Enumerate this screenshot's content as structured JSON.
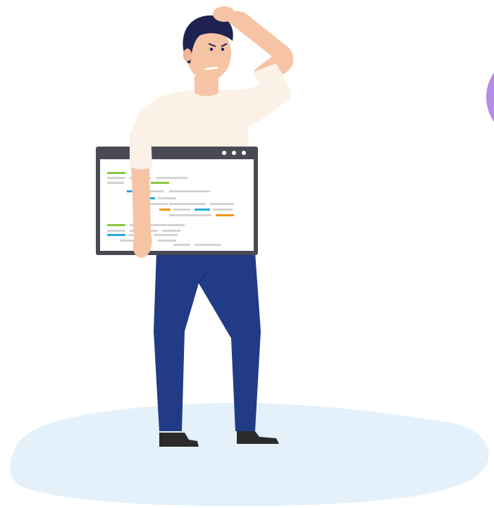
{
  "illustration": {
    "icon": "confused-developer-illustration",
    "colors": {
      "ground": "#e4f1fb",
      "shirt": "#fbf1e6",
      "pants": "#213b86",
      "skin": "#f6c4a5",
      "hair": "#1f2151",
      "shoes": "#2b2b2b",
      "window_frame": "#4a4a55",
      "window_body": "#ffffff",
      "accent_circle": "#b98be3",
      "code_green": "#8cc63f",
      "code_blue": "#29a8e0",
      "code_orange": "#f7941d",
      "code_gray": "#d3d3d3"
    }
  }
}
